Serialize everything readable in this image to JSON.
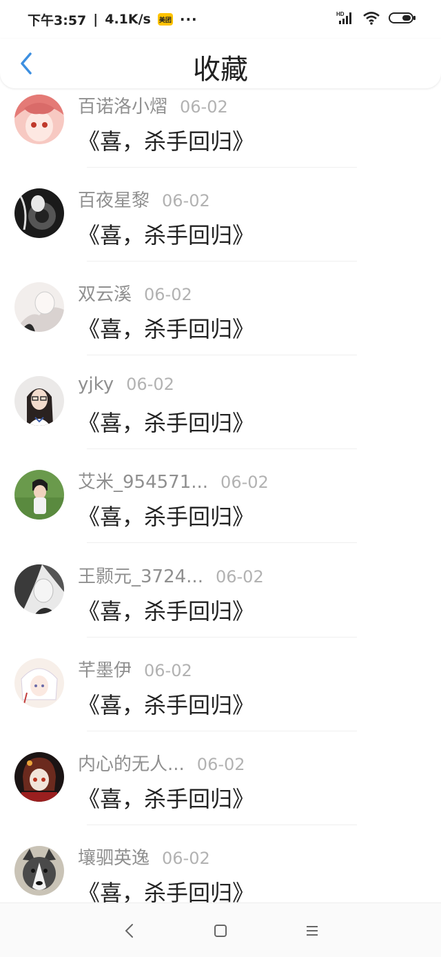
{
  "status": {
    "time": "下午3:57",
    "speed": "4.1K/s",
    "app_badge": "美团",
    "more": "···"
  },
  "header": {
    "title": "收藏"
  },
  "items": [
    {
      "user": "百诺洛小熠",
      "date": "06-02",
      "title": "《喜，杀手回归》"
    },
    {
      "user": "百夜星黎",
      "date": "06-02",
      "title": "《喜，杀手回归》"
    },
    {
      "user": "双云溪",
      "date": "06-02",
      "title": "《喜，杀手回归》"
    },
    {
      "user": "yjky",
      "date": "06-02",
      "title": "《喜，杀手回归》"
    },
    {
      "user": "艾米_954571...",
      "date": "06-02",
      "title": "《喜，杀手回归》"
    },
    {
      "user": "王颢元_3724...",
      "date": "06-02",
      "title": "《喜，杀手回归》"
    },
    {
      "user": "芊墨伊",
      "date": "06-02",
      "title": "《喜，杀手回归》"
    },
    {
      "user": "内心的无人...",
      "date": "06-02",
      "title": "《喜，杀手回归》"
    },
    {
      "user": "壤驷英逸",
      "date": "06-02",
      "title": "《喜，杀手回归》"
    }
  ],
  "colors": {
    "accent": "#3d8fe0"
  }
}
